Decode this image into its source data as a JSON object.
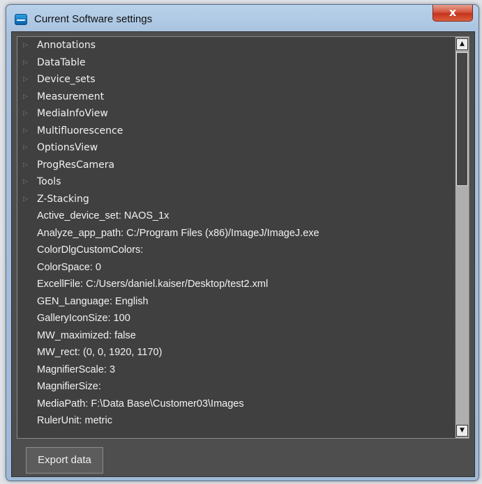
{
  "window": {
    "title": "Current Software settings",
    "close_label": "x"
  },
  "tree": {
    "groups": [
      {
        "label": "Annotations"
      },
      {
        "label": "DataTable"
      },
      {
        "label": "Device_sets"
      },
      {
        "label": "Measurement"
      },
      {
        "label": "MediaInfoView"
      },
      {
        "label": "Multifluorescence"
      },
      {
        "label": "OptionsView"
      },
      {
        "label": "ProgResCamera"
      },
      {
        "label": "Tools"
      },
      {
        "label": "Z-Stacking"
      }
    ],
    "settings": [
      {
        "label": "Active_device_set: NAOS_1x"
      },
      {
        "label": "Analyze_app_path: C:/Program Files (x86)/ImageJ/ImageJ.exe"
      },
      {
        "label": "ColorDlgCustomColors:"
      },
      {
        "label": "ColorSpace: 0"
      },
      {
        "label": "ExcellFile: C:/Users/daniel.kaiser/Desktop/test2.xml"
      },
      {
        "label": "GEN_Language: English"
      },
      {
        "label": "GalleryIconSize: 100"
      },
      {
        "label": "MW_maximized: false"
      },
      {
        "label": "MW_rect: (0, 0, 1920, 1170)"
      },
      {
        "label": "MagnifierScale: 3"
      },
      {
        "label": "MagnifierSize:"
      },
      {
        "label": "MediaPath: F:\\Data Base\\Customer03\\Images"
      },
      {
        "label": "RulerUnit: metric"
      }
    ],
    "expander_icon": "chevron-right-icon",
    "scroll_up_icon": "triangle-up-icon",
    "scroll_down_icon": "triangle-down-icon"
  },
  "footer": {
    "export_label": "Export data"
  },
  "colors": {
    "panel_bg": "#404040",
    "text": "#f2f2f2",
    "close_button": "#c7331c"
  }
}
